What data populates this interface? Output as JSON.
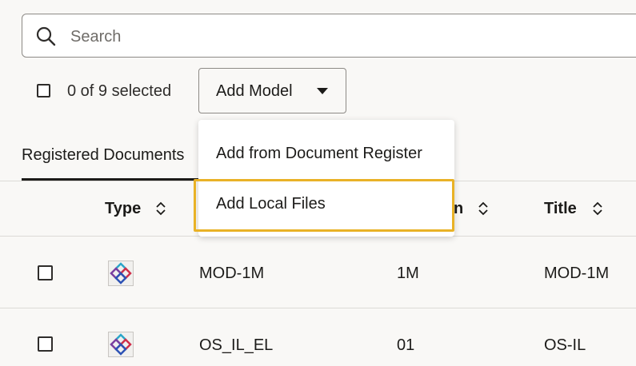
{
  "search": {
    "placeholder": "Search"
  },
  "toolbar": {
    "selection_text": "0 of 9 selected",
    "add_model_label": "Add Model"
  },
  "tabs": [
    {
      "label": "Registered Documents"
    }
  ],
  "dropdown": {
    "items": [
      {
        "label": "Add from Document Register"
      },
      {
        "label": "Add Local Files"
      }
    ],
    "focused_index": 1,
    "focus_color": "#e9b227"
  },
  "table": {
    "columns": [
      {
        "label": "Type"
      },
      {
        "label": "n"
      },
      {
        "label": "Title"
      }
    ],
    "rows": [
      {
        "type_icon": "ifc-model-icon",
        "name": "MOD-1M",
        "version": "1M",
        "title": "MOD-1M"
      },
      {
        "type_icon": "ifc-model-icon",
        "name": "OS_IL_EL",
        "version": "01",
        "title": "OS-IL"
      }
    ]
  }
}
